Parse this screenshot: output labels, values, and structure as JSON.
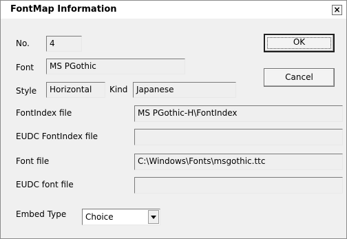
{
  "window": {
    "title": "FontMap Information",
    "close_glyph": "×"
  },
  "fields": {
    "no_label": "No.",
    "no_value": "4",
    "font_label": "Font",
    "font_value": "MS PGothic",
    "style_label": "Style",
    "style_value": "Horizontal",
    "kind_label": "Kind",
    "kind_value": "Japanese",
    "fontindex_label": "FontIndex file",
    "fontindex_value": "MS PGothic-H\\FontIndex",
    "eudc_fontindex_label": "EUDC FontIndex file",
    "eudc_fontindex_value": "",
    "fontfile_label": "Font file",
    "fontfile_value": "C:\\Windows\\Fonts\\msgothic.ttc",
    "eudc_fontfile_label": "EUDC font file",
    "eudc_fontfile_value": "",
    "embed_label": "Embed Type",
    "embed_value": "Choice"
  },
  "buttons": {
    "ok": "OK",
    "cancel": "Cancel"
  },
  "icons": {
    "close": "close-icon",
    "dropdown": "chevron-down-icon"
  }
}
